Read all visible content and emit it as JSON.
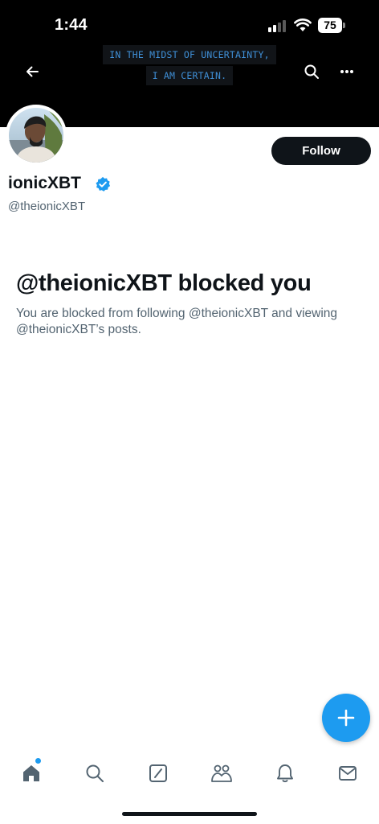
{
  "status_bar": {
    "time": "1:44",
    "battery": "75"
  },
  "header": {
    "banner_lines": [
      "IN THE MIDST OF UNCERTAINTY,",
      "I AM CERTAIN."
    ],
    "icons": {
      "back": "arrow-left-icon",
      "search": "search-icon",
      "more": "more-horizontal-icon"
    }
  },
  "profile": {
    "display_name": "ionicXBT",
    "handle": "@theionicXBT",
    "verified": true,
    "follow_label": "Follow"
  },
  "blocked": {
    "title": "@theionicXBT blocked you",
    "description": "You are blocked from following @theionicXBT and viewing @theionicXBT’s posts."
  },
  "bottom_nav": {
    "items": [
      "home-icon",
      "search-icon",
      "grok-icon",
      "communities-icon",
      "notifications-icon",
      "messages-icon"
    ],
    "active": "home-icon"
  },
  "colors": {
    "accent": "#1d9bf0",
    "text_primary": "#0f1419",
    "text_secondary": "#536471",
    "banner_text": "#3f8fd6"
  }
}
